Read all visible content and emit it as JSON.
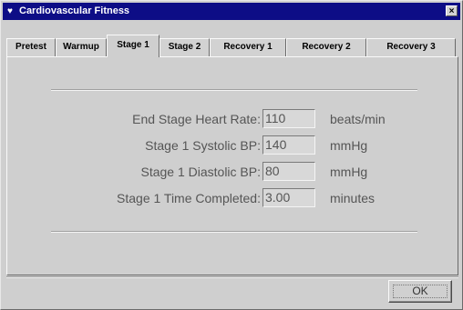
{
  "window": {
    "title": "Cardiovascular Fitness",
    "icon": "heart-icon",
    "close_glyph": "×"
  },
  "tabs": [
    {
      "label": "Pretest",
      "active": false
    },
    {
      "label": "Warmup",
      "active": false
    },
    {
      "label": "Stage 1",
      "active": true
    },
    {
      "label": "Stage 2",
      "active": false
    },
    {
      "label": "Recovery 1",
      "active": false
    },
    {
      "label": "Recovery 2",
      "active": false
    },
    {
      "label": "Recovery 3",
      "active": false
    }
  ],
  "fields": [
    {
      "label": "End Stage Heart Rate:",
      "value": "110",
      "unit": "beats/min"
    },
    {
      "label": "Stage 1 Systolic BP:",
      "value": "140",
      "unit": "mmHg"
    },
    {
      "label": "Stage 1 Diastolic BP:",
      "value": "80",
      "unit": "mmHg"
    },
    {
      "label": "Stage 1 Time Completed:",
      "value": "3.00",
      "unit": "minutes"
    }
  ],
  "buttons": {
    "ok_label": "OK"
  },
  "colors": {
    "titlebar": "#0d0d86",
    "face": "#cfcfcf"
  }
}
